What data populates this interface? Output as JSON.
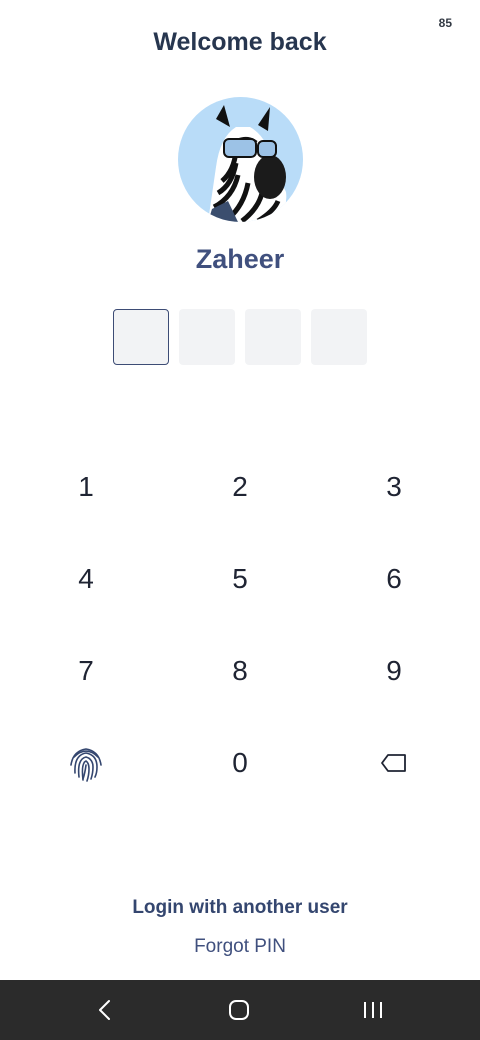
{
  "status_bar": {
    "indicator": "85"
  },
  "header": {
    "title": "Welcome back"
  },
  "user": {
    "name": "Zaheer",
    "avatar_icon": "zebra-with-sunglasses-avatar",
    "avatar_bg": "#b9dcf8"
  },
  "pin": {
    "length": 4,
    "filled": 0,
    "active_index": 0
  },
  "keypad": {
    "keys": [
      "1",
      "2",
      "3",
      "4",
      "5",
      "6",
      "7",
      "8",
      "9"
    ],
    "zero": "0",
    "left_icon": "fingerprint-icon",
    "right_icon": "backspace-icon"
  },
  "actions": {
    "login_another": "Login with another user",
    "forgot_pin": "Forgot PIN"
  },
  "navigation_bar": {
    "back_icon": "back-icon",
    "home_icon": "home-icon",
    "recents_icon": "recents-icon"
  },
  "colors": {
    "title": "#27364f",
    "accent": "#40507e",
    "navbar_bg": "#2b2b2b"
  }
}
